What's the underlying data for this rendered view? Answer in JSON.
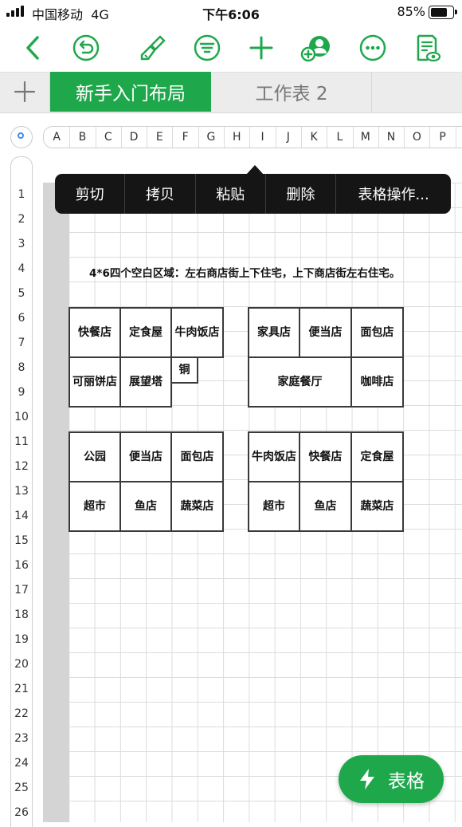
{
  "status": {
    "carrier": "中国移动",
    "network": "4G",
    "time": "下午6:06",
    "battery": "85%",
    "battery_level": 0.85
  },
  "toolbar": {
    "icons": [
      "back-chevron-icon",
      "undo-icon",
      "format-brush-icon",
      "filter-icon",
      "add-icon",
      "share-collaborate-icon",
      "more-icon",
      "document-view-icon"
    ],
    "accent": "#1fa84b"
  },
  "tabs": {
    "active": "新手入门布局",
    "second": "工作表 2"
  },
  "columns": [
    "A",
    "B",
    "C",
    "D",
    "E",
    "F",
    "G",
    "H",
    "I",
    "J",
    "K",
    "L",
    "M",
    "N",
    "O",
    "P"
  ],
  "rows": [
    "1",
    "2",
    "3",
    "4",
    "5",
    "6",
    "7",
    "8",
    "9",
    "10",
    "11",
    "12",
    "13",
    "14",
    "15",
    "16",
    "17",
    "18",
    "19",
    "20",
    "21",
    "22",
    "23",
    "24",
    "25",
    "26"
  ],
  "context_menu": [
    "剪切",
    "拷贝",
    "粘贴",
    "删除",
    "表格操作..."
  ],
  "note": "4*6四个空白区域：左右商店街上下住宅，上下商店街左右住宅。",
  "blocks": {
    "top_left": [
      "快餐店",
      "定食屋",
      "牛肉饭店",
      "可丽饼店",
      "展望塔",
      "铜"
    ],
    "top_right": [
      "家具店",
      "便当店",
      "面包店",
      "家庭餐厅",
      "咖啡店"
    ],
    "bottom_left": [
      "公园",
      "便当店",
      "面包店",
      "超市",
      "鱼店",
      "蔬菜店"
    ],
    "bottom_right": [
      "牛肉饭店",
      "快餐店",
      "定食屋",
      "超市",
      "鱼店",
      "蔬菜店"
    ]
  },
  "fab": {
    "label": "表格",
    "icon": "lightning-icon"
  }
}
